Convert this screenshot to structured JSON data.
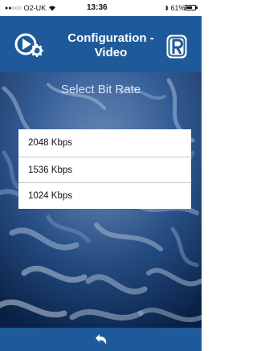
{
  "status_bar": {
    "signal_dots": "●●○○○",
    "carrier": "O2-UK",
    "wifi_icon": "wifi-icon",
    "time": "13:36",
    "bluetooth_icon": "bluetooth-icon",
    "battery_text": "61%",
    "battery_level": 0.61
  },
  "header": {
    "title_line1": "Configuration -",
    "title_line2": "Video",
    "left_icon": "video-settings-icon",
    "right_icon": "app-logo-icon",
    "background_color": "#1e5a9a"
  },
  "main": {
    "section_title": "Select Bit Rate",
    "bitrates": [
      {
        "label": "2048 Kbps"
      },
      {
        "label": "1536 Kbps"
      },
      {
        "label": "1024 Kbps"
      }
    ]
  },
  "footer": {
    "back_icon": "back-arrow-icon"
  }
}
